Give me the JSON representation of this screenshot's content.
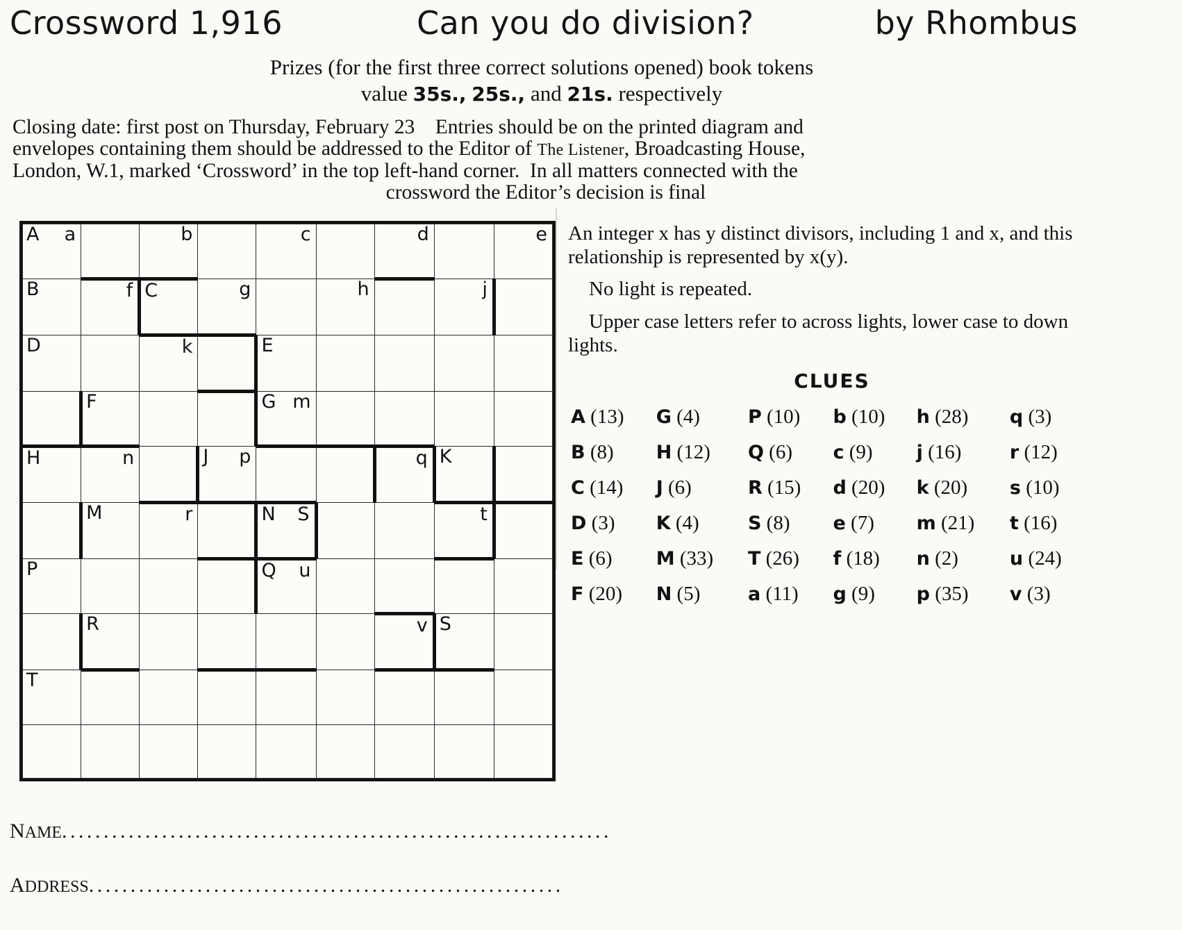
{
  "header": {
    "left": "Crossword 1,916",
    "center": "Can you do division?",
    "right": "by Rhombus"
  },
  "prize": {
    "line1": "Prizes (for the first three correct solutions opened) book tokens",
    "line2_pre": "value ",
    "value1": "35s.,",
    "value2": "25s.,",
    "line2_mid": " and ",
    "value3": "21s.",
    "line2_post": " respectively"
  },
  "rules": {
    "line1": "Closing date: first post on Thursday, February 23 Entries should be on the printed diagram and",
    "line2a": "envelopes containing them should be addressed to the Editor of ",
    "line2_sc": "The Listener",
    "line2b": ", Broadcasting House,",
    "line3": "London, W.1, marked ‘Crossword’ in the top left-hand corner. In all matters connected with the",
    "line4": "crossword the Editor’s decision is final"
  },
  "notes": [
    "An integer x has y distinct divisors, including 1 and x, and this relationship is represented by x(y).",
    "No light is repeated.",
    "Upper case letters refer to across lights, lower case to down lights."
  ],
  "clues_title": "CLUES",
  "clues_rows": [
    [
      [
        "A",
        "(13)"
      ],
      [
        "G",
        "(4)"
      ],
      [
        "P",
        "(10)"
      ],
      [
        "b",
        "(10)"
      ],
      [
        "h",
        "(28)"
      ],
      [
        "q",
        "(3)"
      ]
    ],
    [
      [
        "B",
        "(8)"
      ],
      [
        "H",
        "(12)"
      ],
      [
        "Q",
        "(6)"
      ],
      [
        "c",
        "(9)"
      ],
      [
        "j",
        "(16)"
      ],
      [
        "r",
        "(12)"
      ]
    ],
    [
      [
        "C",
        "(14)"
      ],
      [
        "J",
        "(6)"
      ],
      [
        "R",
        "(15)"
      ],
      [
        "d",
        "(20)"
      ],
      [
        "k",
        "(20)"
      ],
      [
        "s",
        "(10)"
      ]
    ],
    [
      [
        "D",
        "(3)"
      ],
      [
        "K",
        "(4)"
      ],
      [
        "S",
        "(8)"
      ],
      [
        "e",
        "(7)"
      ],
      [
        "m",
        "(21)"
      ],
      [
        "t",
        "(16)"
      ]
    ],
    [
      [
        "E",
        "(6)"
      ],
      [
        "M",
        "(33)"
      ],
      [
        "T",
        "(26)"
      ],
      [
        "f",
        "(18)"
      ],
      [
        "n",
        "(2)"
      ],
      [
        "u",
        "(24)"
      ]
    ],
    [
      [
        "F",
        "(20)"
      ],
      [
        "N",
        "(5)"
      ],
      [
        "a",
        "(11)"
      ],
      [
        "g",
        "(9)"
      ],
      [
        "p",
        "(35)"
      ],
      [
        "v",
        "(3)"
      ]
    ]
  ],
  "grid": {
    "cols": 9,
    "rows": 10,
    "cells": [
      [
        {
          "l": "A",
          "r": "a"
        },
        {},
        {
          "r": "b"
        },
        {},
        {
          "r": "c"
        },
        {},
        {
          "r": "d"
        },
        {},
        {
          "r": "e"
        }
      ],
      [
        {
          "l": "B"
        },
        {
          "r": "f"
        },
        {
          "l": "C"
        },
        {
          "r": "g"
        },
        {},
        {
          "r": "h"
        },
        {},
        {
          "r": "j"
        },
        {}
      ],
      [
        {
          "l": "D"
        },
        {},
        {
          "r": "k"
        },
        {},
        {
          "l": "E"
        },
        {},
        {},
        {},
        {}
      ],
      [
        {},
        {
          "l": "F"
        },
        {},
        {},
        {
          "l": "G",
          "r": "m"
        },
        {},
        {},
        {},
        {}
      ],
      [
        {
          "l": "H"
        },
        {
          "r": "n"
        },
        {},
        {
          "l": "J",
          "r": "p"
        },
        {},
        {},
        {
          "r": "q"
        },
        {
          "l": "K"
        },
        {}
      ],
      [
        {},
        {
          "l": "M"
        },
        {
          "r": "r"
        },
        {},
        {
          "l": "N",
          "r": "S"
        },
        {},
        {},
        {
          "r": "t"
        },
        {}
      ],
      [
        {
          "l": "P"
        },
        {},
        {},
        {},
        {
          "l": "Q",
          "r": "u"
        },
        {},
        {},
        {},
        {}
      ],
      [
        {},
        {
          "l": "R"
        },
        {},
        {},
        {},
        {},
        {
          "r": "v"
        },
        {
          "l": "S"
        },
        {}
      ],
      [
        {
          "l": "T"
        },
        {},
        {},
        {},
        {},
        {},
        {},
        {},
        {}
      ],
      [
        {},
        {},
        {},
        {},
        {},
        {},
        {},
        {},
        {}
      ]
    ],
    "thick": {
      "bottom": [
        [
          0,
          1
        ],
        [
          0,
          2
        ],
        [
          0,
          6
        ],
        [
          1,
          2
        ],
        [
          1,
          3
        ],
        [
          2,
          3
        ],
        [
          3,
          0
        ],
        [
          3,
          1
        ],
        [
          3,
          4
        ],
        [
          3,
          5
        ],
        [
          4,
          2
        ],
        [
          4,
          3
        ],
        [
          4,
          7
        ],
        [
          4,
          8
        ],
        [
          5,
          3
        ],
        [
          5,
          4
        ],
        [
          5,
          7
        ],
        [
          6,
          6
        ],
        [
          7,
          1
        ],
        [
          7,
          3
        ],
        [
          7,
          4
        ],
        [
          7,
          6
        ],
        [
          7,
          7
        ]
      ],
      "right": [
        [
          1,
          1
        ],
        [
          1,
          7
        ],
        [
          2,
          3
        ],
        [
          3,
          3
        ],
        [
          4,
          2
        ],
        [
          4,
          6
        ],
        [
          4,
          7
        ],
        [
          5,
          4
        ],
        [
          5,
          7
        ],
        [
          6,
          3
        ],
        [
          7,
          6
        ]
      ],
      "left": [
        [
          3,
          1
        ],
        [
          3,
          4
        ],
        [
          4,
          3
        ],
        [
          5,
          1
        ],
        [
          5,
          4
        ],
        [
          6,
          4
        ],
        [
          7,
          1
        ],
        [
          7,
          7
        ],
        [
          2,
          4
        ],
        [
          4,
          6
        ]
      ],
      "top": [
        [
          4,
          6
        ],
        [
          5,
          4
        ],
        [
          6,
          4
        ],
        [
          7,
          6
        ]
      ]
    }
  },
  "form": {
    "name_label": "Name",
    "name_label_cap": "N",
    "address_label": "Address",
    "address_label_cap": "A",
    "name_dots": "...............................................................",
    "name_dots_tail": "...",
    "address_dots": "........................................................."
  }
}
